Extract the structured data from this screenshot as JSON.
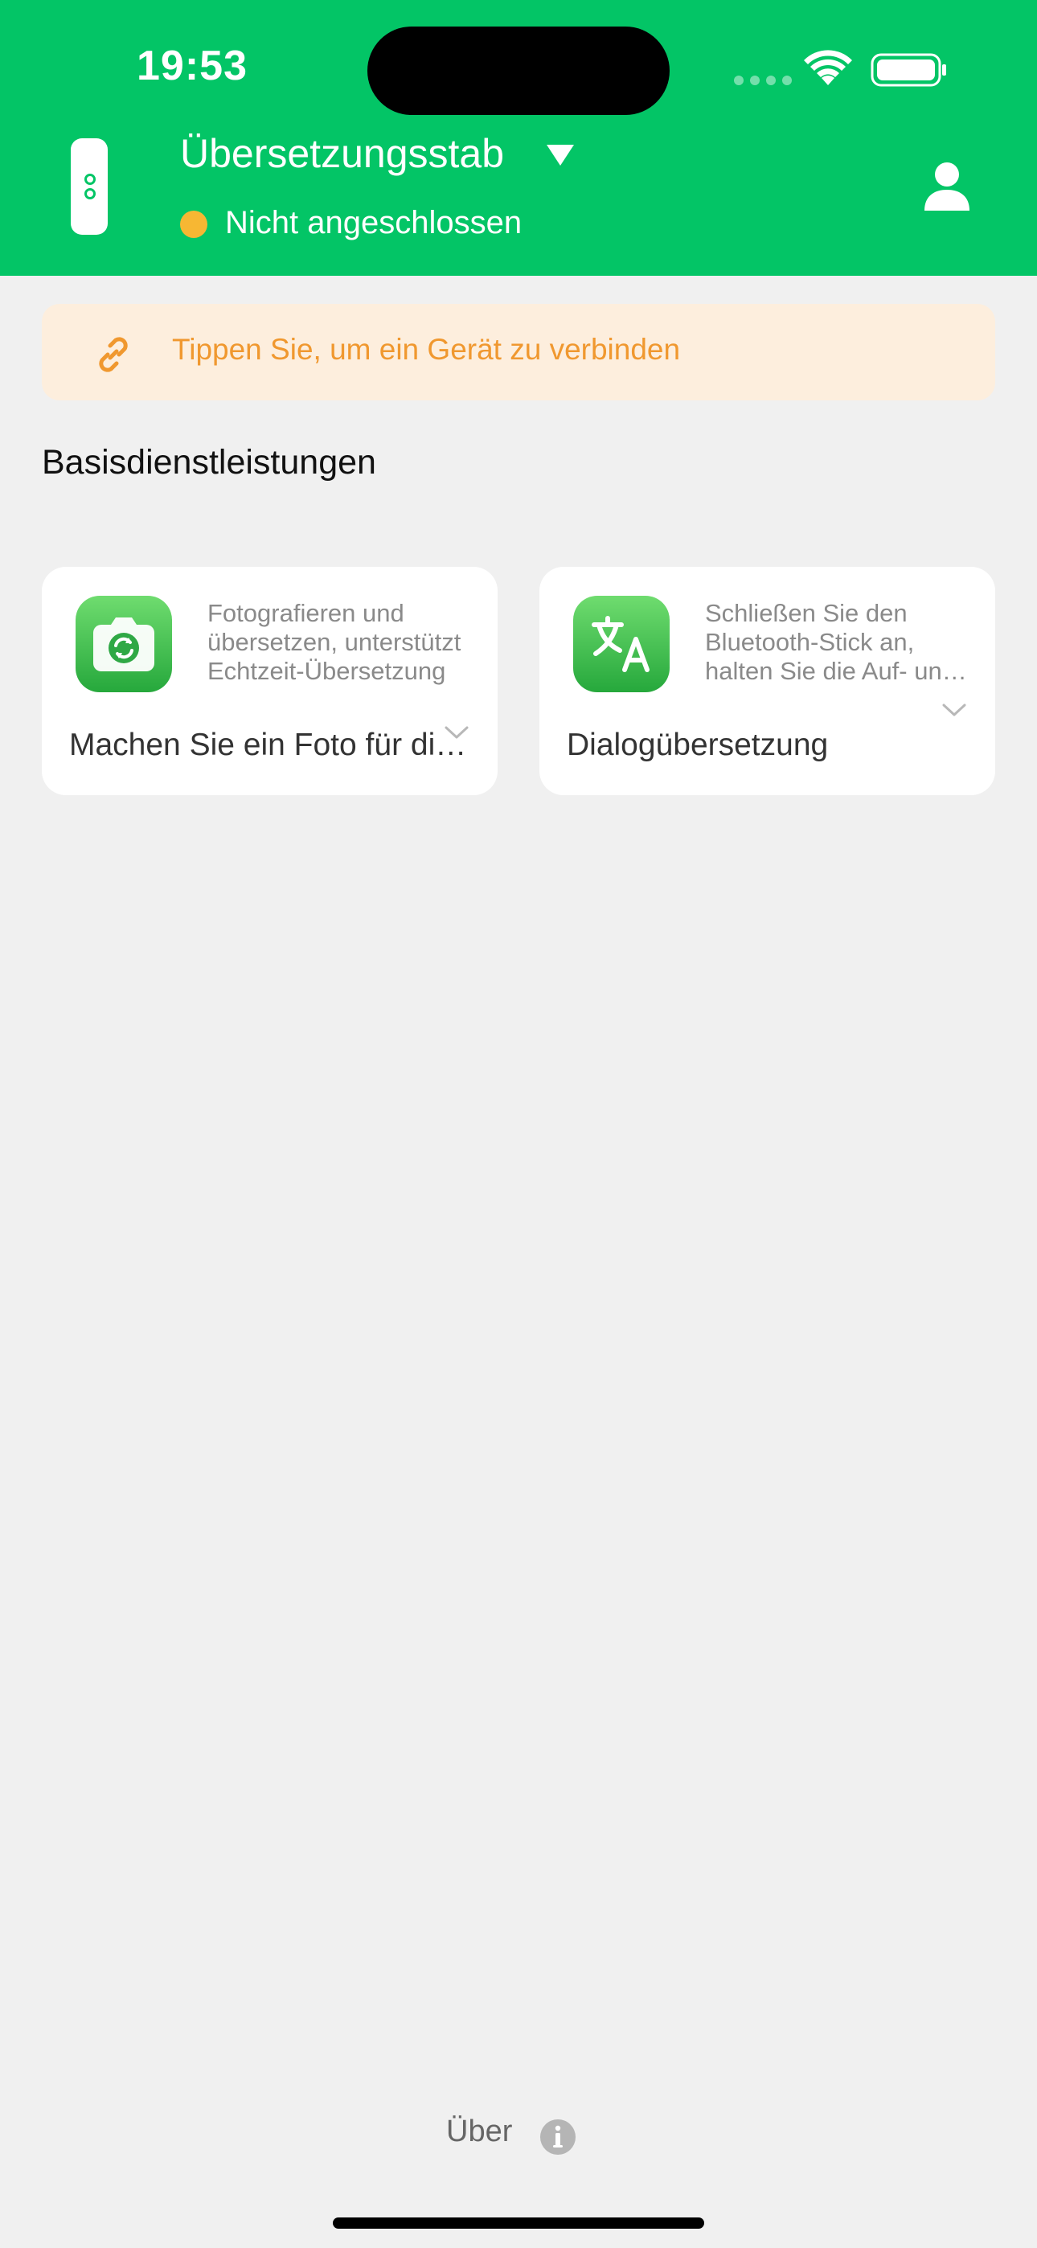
{
  "status_bar": {
    "time": "19:53"
  },
  "header": {
    "title": "Übersetzungsstab",
    "status": "Nicht angeschlossen",
    "colors": {
      "background": "#03c566",
      "status_dot": "#f7b733"
    }
  },
  "banner": {
    "text": "Tippen Sie, um ein Gerät zu verbinden",
    "color": "#f0982f"
  },
  "section": {
    "title": "Basisdienstleistungen"
  },
  "cards": [
    {
      "icon": "camera-translate-icon",
      "description": "Fotografieren und übersetzen, unterstützt Echtzeit-Übersetzung",
      "title": "Machen Sie ein Foto für die Übersetzung"
    },
    {
      "icon": "translate-icon",
      "description": "Schließen Sie den Bluetooth-Stick an, halten Sie die Auf- und Ab-Taste gedrückt",
      "title": "Dialogübersetzung"
    }
  ],
  "footer": {
    "about_label": "Über"
  }
}
